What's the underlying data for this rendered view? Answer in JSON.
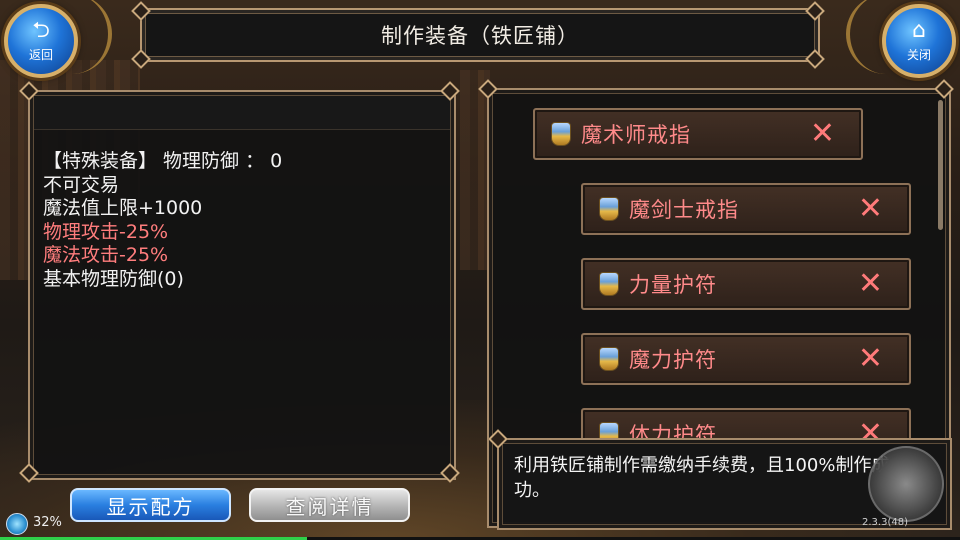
{
  "title": "制作装备（铁匠铺）",
  "nav": {
    "back_label": "返回",
    "close_label": "关闭"
  },
  "item_stats": {
    "line1": "【特殊装备】 物理防御 ： 0",
    "line2": "不可交易",
    "line3": "魔法值上限+1000",
    "line4": "物理攻击-25%",
    "line5": "魔法攻击-25%",
    "line6": "基本物理防御(0)"
  },
  "recipes": [
    {
      "name": "魔术师戒指",
      "icon": "gem-icon",
      "remove": "✕"
    },
    {
      "name": "魔剑士戒指",
      "icon": "gem-icon",
      "remove": "✕"
    },
    {
      "name": "力量护符",
      "icon": "gem-icon",
      "remove": "✕"
    },
    {
      "name": "魔力护符",
      "icon": "gem-icon",
      "remove": "✕"
    },
    {
      "name": "体力护符",
      "icon": "gem-icon",
      "remove": "✕"
    }
  ],
  "info": {
    "text": "利用铁匠铺制作需缴纳手续费，且100%制作成功。"
  },
  "buttons": {
    "show_recipe": "显示配方",
    "view_details": "查阅详情"
  },
  "status": {
    "battery": "32%",
    "battery_level": 0.32,
    "version": "2.3.3(48)"
  },
  "colors": {
    "negative_stat": "#ff7d7d",
    "recipe_text": "#ff8a8a",
    "frame": "#a88c6c",
    "primary_button": "#2a7fe0"
  }
}
